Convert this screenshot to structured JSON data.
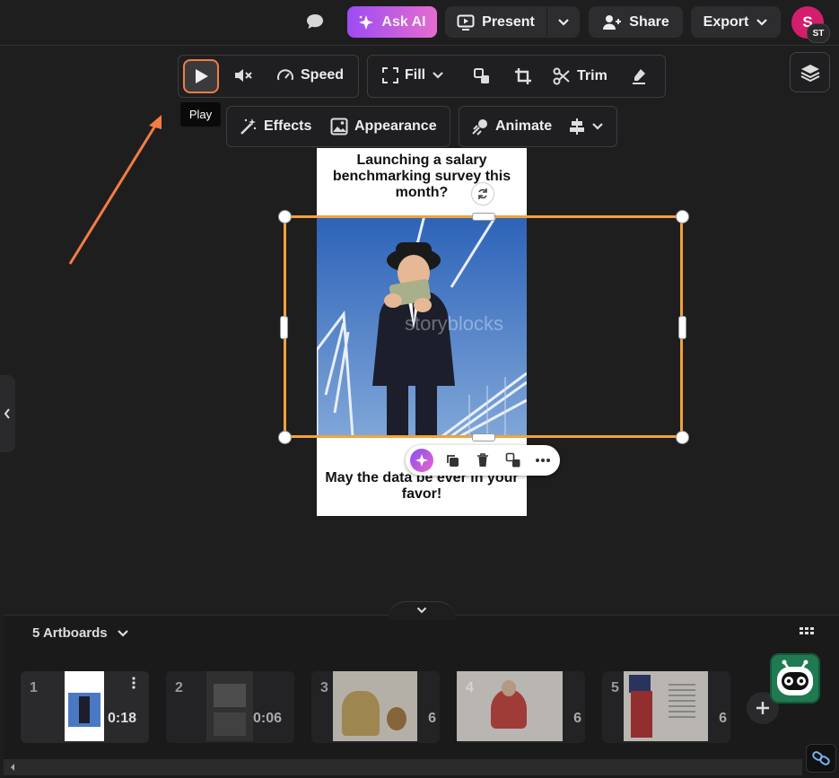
{
  "topbar": {
    "ask_ai": "Ask AI",
    "present": "Present",
    "share": "Share",
    "export": "Export",
    "avatar_initial": "S",
    "avatar_badge": "ST"
  },
  "video_toolbar": {
    "speed": "Speed",
    "fill": "Fill",
    "trim": "Trim",
    "effects": "Effects",
    "appearance": "Appearance",
    "animate": "Animate",
    "tooltip": "Play"
  },
  "artboard": {
    "top_caption": "Launching a salary benchmarking survey this month?",
    "bottom_caption": "May the data be ever in your favor!",
    "watermark": "storyblocks"
  },
  "bottom_panel": {
    "artboards_label": "5 Artboards",
    "thumbnails": [
      {
        "num": "1",
        "duration": "0:18"
      },
      {
        "num": "2",
        "duration": "0:06"
      },
      {
        "num": "3",
        "duration": "6"
      },
      {
        "num": "4",
        "duration": "6"
      },
      {
        "num": "5",
        "duration": "6"
      }
    ]
  },
  "colors": {
    "accent": "#f47c45",
    "selection": "#f2a23a",
    "ask_ai_gradient_start": "#9c4cf4",
    "ask_ai_gradient_end": "#e66ccf",
    "avatar": "#d41d6d"
  },
  "icons": [
    "chat-icon",
    "sparkle-icon",
    "present-icon",
    "chevron-down-icon",
    "add-user-icon",
    "play-icon",
    "mute-icon",
    "speed-icon",
    "fill-icon",
    "swap-icon",
    "crop-icon",
    "scissors-icon",
    "eraser-icon",
    "effects-wand-icon",
    "appearance-image-icon",
    "animate-icon",
    "align-icon",
    "layers-icon",
    "rotate-icon",
    "ai-sparkle-icon",
    "duplicate-icon",
    "trash-icon",
    "replace-icon",
    "more-icon",
    "grid-icon",
    "plus-icon",
    "robot-icon",
    "link-icon",
    "chevron-left-icon"
  ]
}
